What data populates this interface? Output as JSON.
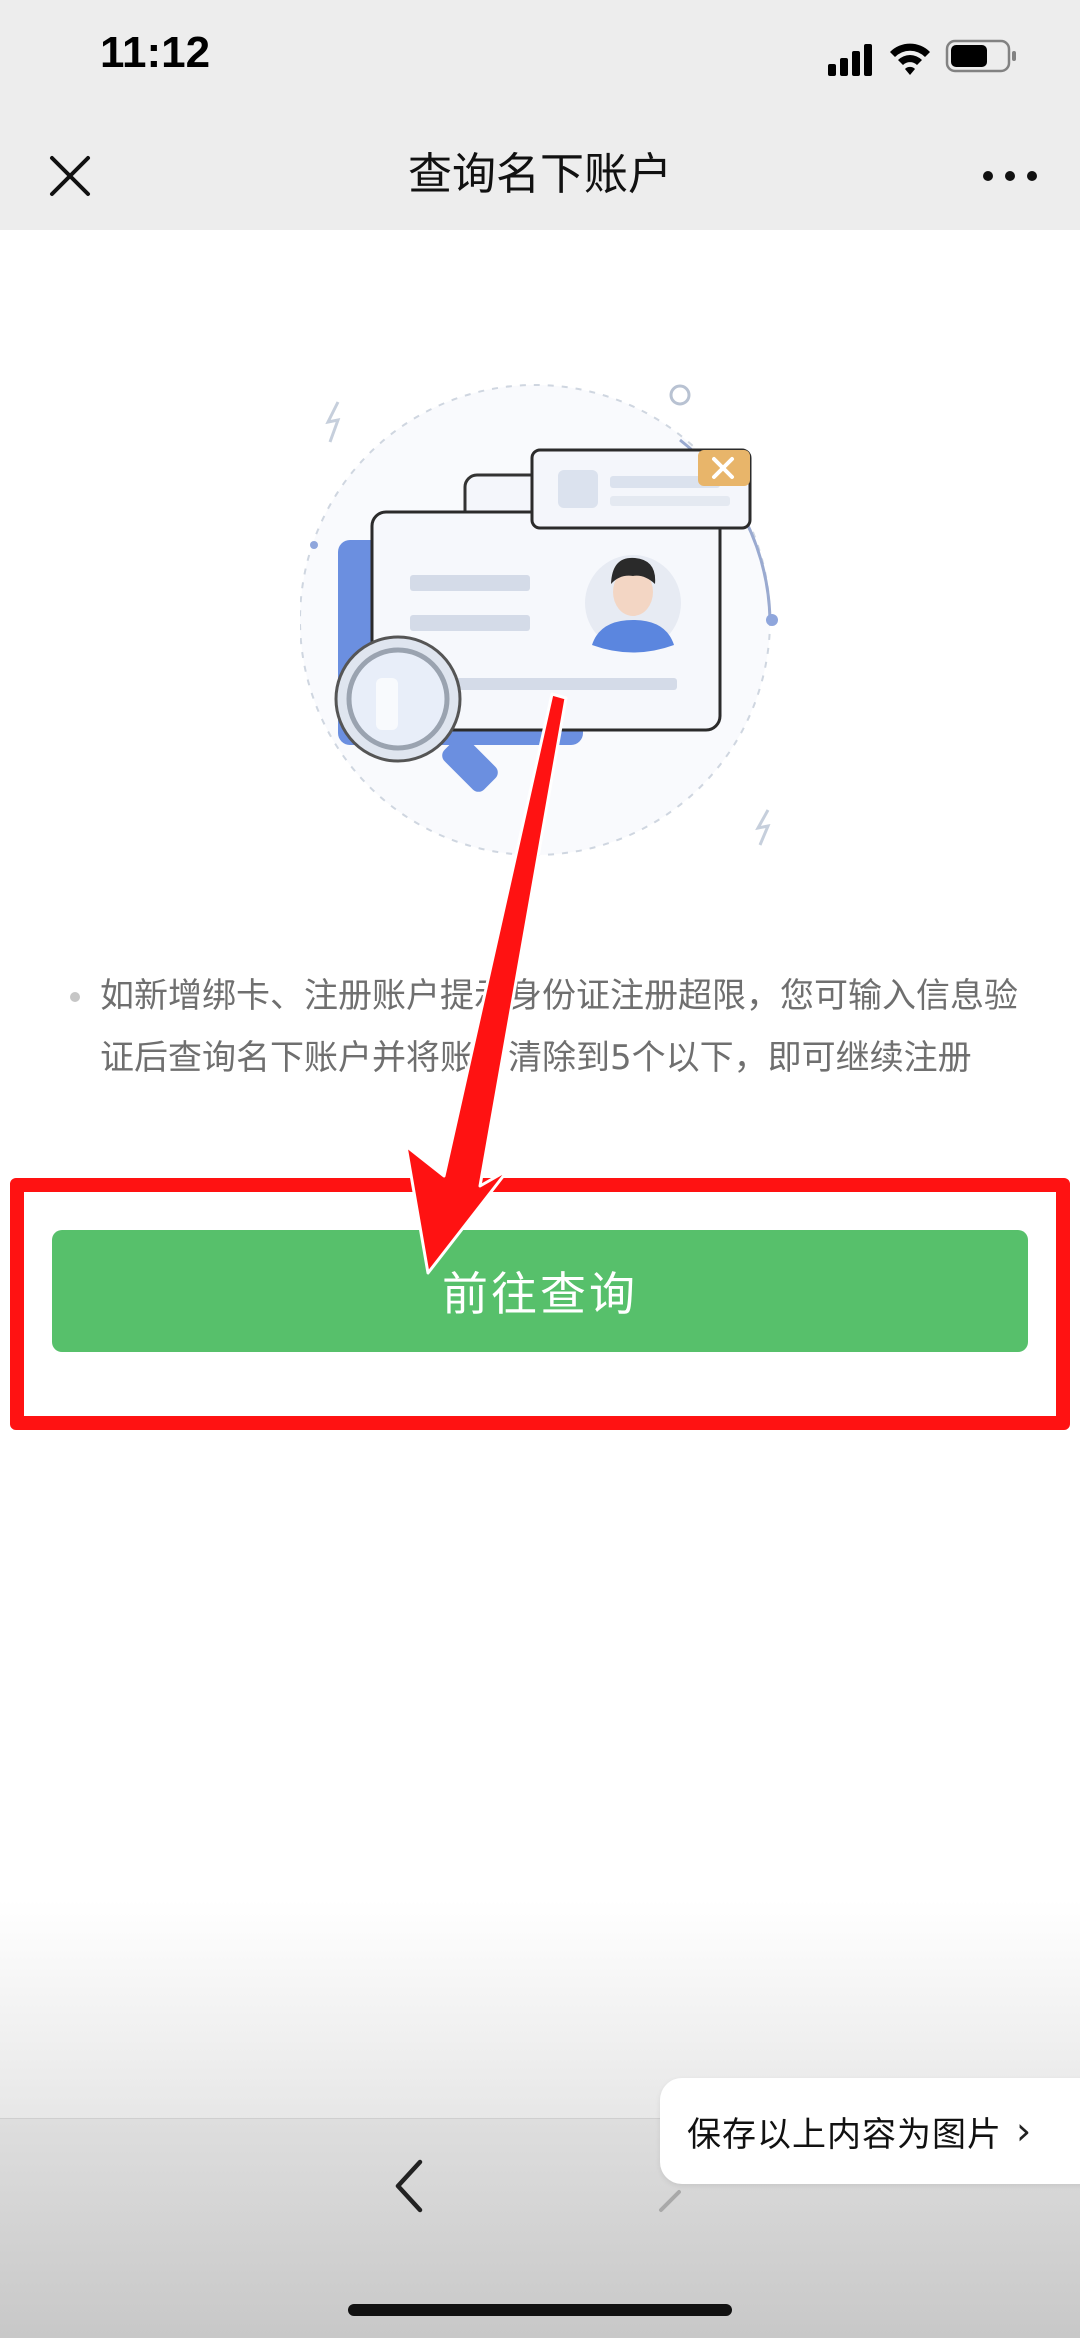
{
  "status": {
    "time": "11:12",
    "icons": [
      "signal-icon",
      "wifi-icon",
      "battery-icon"
    ]
  },
  "nav": {
    "title": "查询名下账户",
    "close_icon": "close-icon",
    "more_icon": "more-icon"
  },
  "tip": {
    "text": "如新增绑卡、注册账户提示身份证注册超限，您可输入信息验证后查询名下账户并将账户清除到5个以下，即可继续注册"
  },
  "cta": {
    "label": "前往查询"
  },
  "toolbar": {
    "save_label": "保存以上内容为图片",
    "back_icon": "chevron-left-icon",
    "forward_icon": "chevron-right-icon"
  },
  "colors": {
    "primary_green": "#57c06b",
    "highlight_red": "#ff1212",
    "header_bg": "#ededed",
    "illustration_blue": "#6b8fe0"
  }
}
